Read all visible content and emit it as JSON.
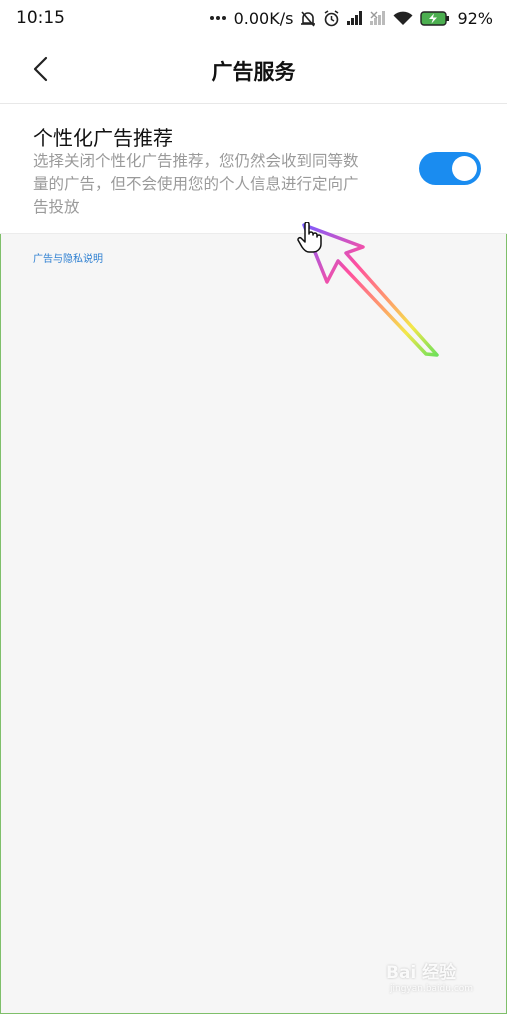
{
  "status_bar": {
    "time": "10:15",
    "network_speed": "0.00K/s",
    "battery_percent": "92%",
    "icons": [
      "more-dots-icon",
      "notification-off-icon",
      "alarm-clock-icon",
      "signal-icon",
      "signal-no-sim-icon",
      "wifi-icon",
      "battery-charging-icon"
    ]
  },
  "header": {
    "back_icon": "chevron-left-icon",
    "title": "广告服务"
  },
  "setting": {
    "title": "个性化广告推荐",
    "description": "选择关闭个性化广告推荐，您仍然会收到同等数量的广告，但不会使用您的个人信息进行定向广告投放",
    "toggle_on": true
  },
  "privacy_link": "广告与隐私说明",
  "watermark": {
    "logo_text": "Bai 经验",
    "url": "jingyan.baidu.com"
  },
  "colors": {
    "accent": "#1a8cf0",
    "background": "#f6f6f6",
    "link": "#2d7fd1"
  }
}
